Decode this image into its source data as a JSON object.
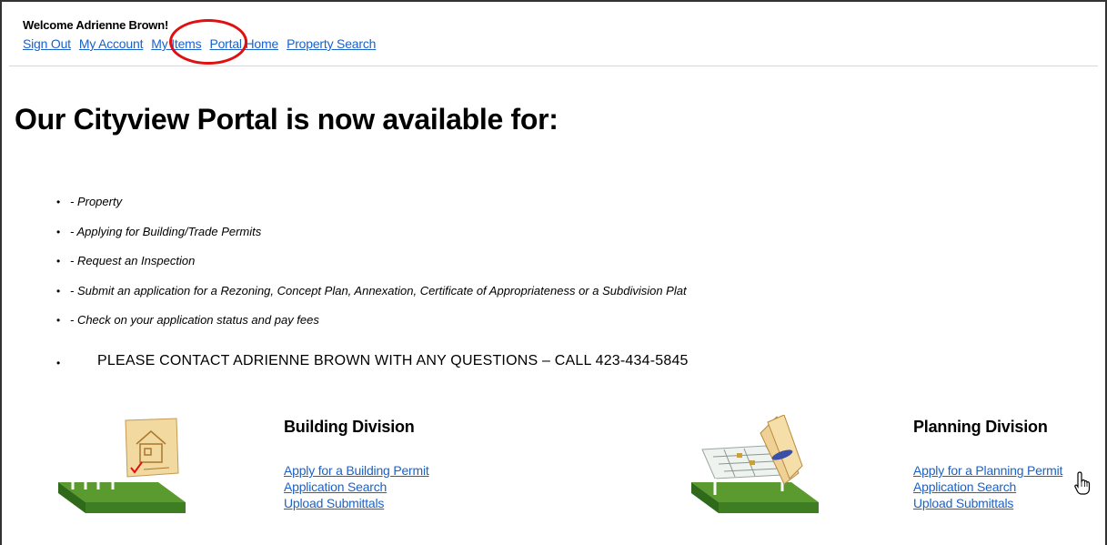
{
  "header": {
    "welcome": "Welcome Adrienne Brown!",
    "nav": [
      "Sign Out",
      "My Account",
      "My Items",
      "Portal Home",
      "Property Search"
    ],
    "highlighted_item": "My Items"
  },
  "main": {
    "headline": "Our Cityview Portal is now available for:",
    "features": [
      "- Property",
      "- Applying for Building/Trade Permits",
      "- Request an Inspection",
      "- Submit an application for a Rezoning, Concept Plan, Annexation, Certificate of Appropriateness or a Subdivision Plat",
      "- Check on your application status and pay fees"
    ],
    "contact": "PLEASE CONTACT ADRIENNE BROWN WITH ANY QUESTIONS – CALL 423-434-5845"
  },
  "building": {
    "title": "Building Division",
    "links": [
      "Apply for a Building Permit",
      "Application Search",
      "Upload Submittals"
    ],
    "icon": "house-blueprint-illustration"
  },
  "planning": {
    "title": "Planning Division",
    "links": [
      "Apply for a Planning Permit",
      "Application Search",
      "Upload Submittals"
    ],
    "icon": "planning-blueprint-illustration"
  },
  "colors": {
    "link": "#1a62c9",
    "highlight": "#e01010",
    "grass": "#5a9a2e"
  }
}
